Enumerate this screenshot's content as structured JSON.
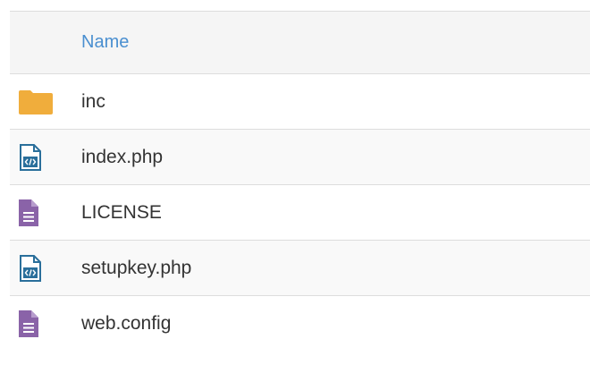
{
  "header": {
    "name_label": "Name"
  },
  "files": [
    {
      "name": "inc",
      "icon": "folder-icon"
    },
    {
      "name": "index.php",
      "icon": "code-file-icon"
    },
    {
      "name": "LICENSE",
      "icon": "text-file-icon"
    },
    {
      "name": "setupkey.php",
      "icon": "code-file-icon"
    },
    {
      "name": "web.config",
      "icon": "text-file-icon"
    }
  ],
  "colors": {
    "header_link": "#4a8fd0",
    "folder": "#f0ad3c",
    "text_file": "#8a63a8",
    "code_file": "#2a6f9b"
  }
}
